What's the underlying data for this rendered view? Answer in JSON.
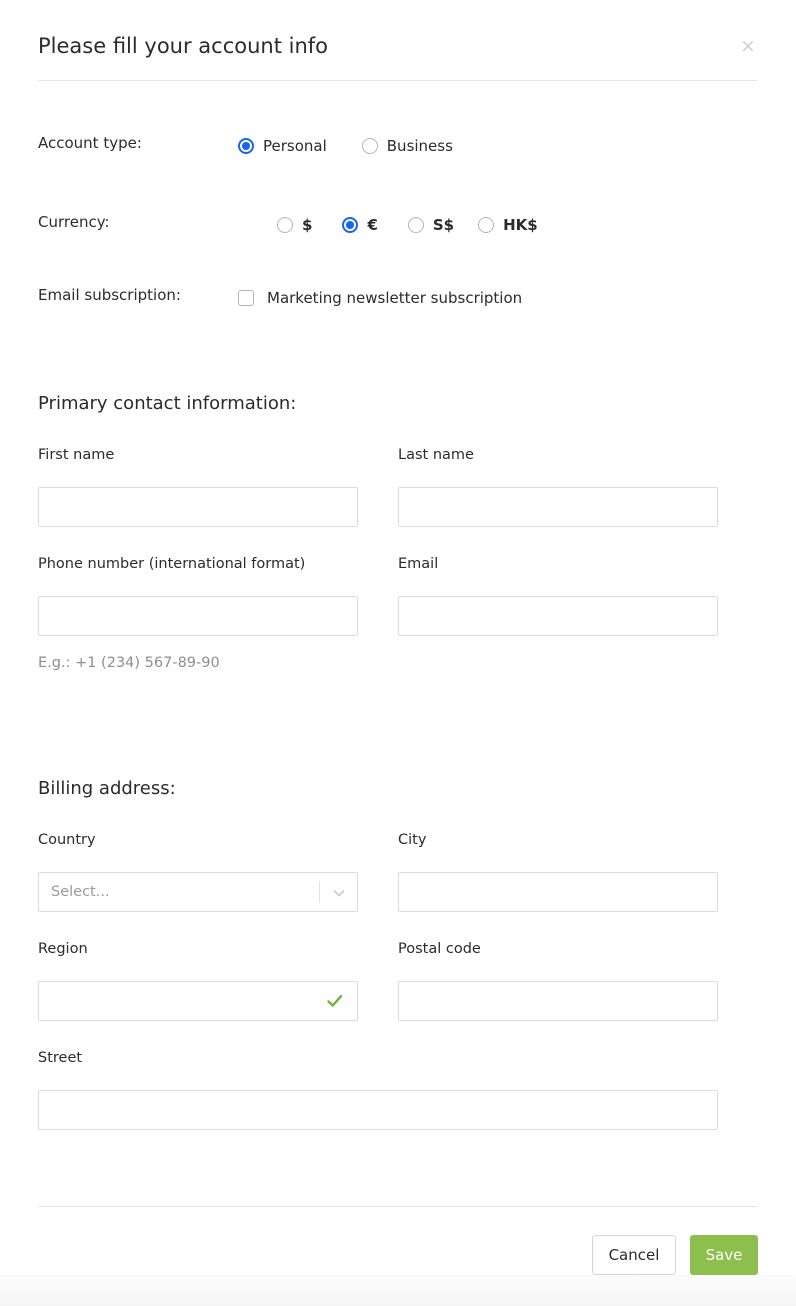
{
  "dialog": {
    "title": "Please fill your account info",
    "close_icon": "close-icon",
    "close_label": "×"
  },
  "options": {
    "account_type": {
      "label": "Account type:",
      "choices": [
        {
          "label": "Personal",
          "checked": true
        },
        {
          "label": "Business",
          "checked": false
        }
      ]
    },
    "currency": {
      "label": "Currency:",
      "choices": [
        {
          "label": "$",
          "checked": false
        },
        {
          "label": "€",
          "checked": true
        },
        {
          "label": "S$",
          "checked": false
        },
        {
          "label": "HK$",
          "checked": false
        }
      ]
    },
    "email_subscription": {
      "label": "Email subscription:",
      "checkbox_label": "Marketing newsletter subscription",
      "checked": false
    }
  },
  "primary_contact": {
    "heading": "Primary contact information:",
    "first_name": {
      "label": "First name",
      "value": "",
      "placeholder": ""
    },
    "last_name": {
      "label": "Last name",
      "value": "",
      "placeholder": ""
    },
    "phone": {
      "label": "Phone number (international format)",
      "value": "",
      "placeholder": ""
    },
    "email": {
      "label": "Email",
      "value": "",
      "placeholder": ""
    },
    "phone_hint": "E.g.: +1 (234) 567-89-90"
  },
  "billing_address": {
    "heading": "Billing address:",
    "country": {
      "label": "Country",
      "selected": "Select...",
      "icon": "chevron-down-icon"
    },
    "city": {
      "label": "City",
      "value": "",
      "placeholder": ""
    },
    "region": {
      "label": "Region",
      "value": "",
      "placeholder": "",
      "status_icon": "check-icon"
    },
    "postal_code": {
      "label": "Postal code",
      "value": "",
      "placeholder": ""
    },
    "street": {
      "label": "Street",
      "value": "",
      "placeholder": ""
    }
  },
  "footer": {
    "cancel_label": "Cancel",
    "save_label": "Save"
  },
  "colors": {
    "accent_radio": "#1565ef",
    "save_button": "#8cbf4d",
    "valid_check": "#6cb33f",
    "border": "#dcdcdc",
    "text": "#2b2b2b",
    "muted_text": "#8e8e8e"
  }
}
